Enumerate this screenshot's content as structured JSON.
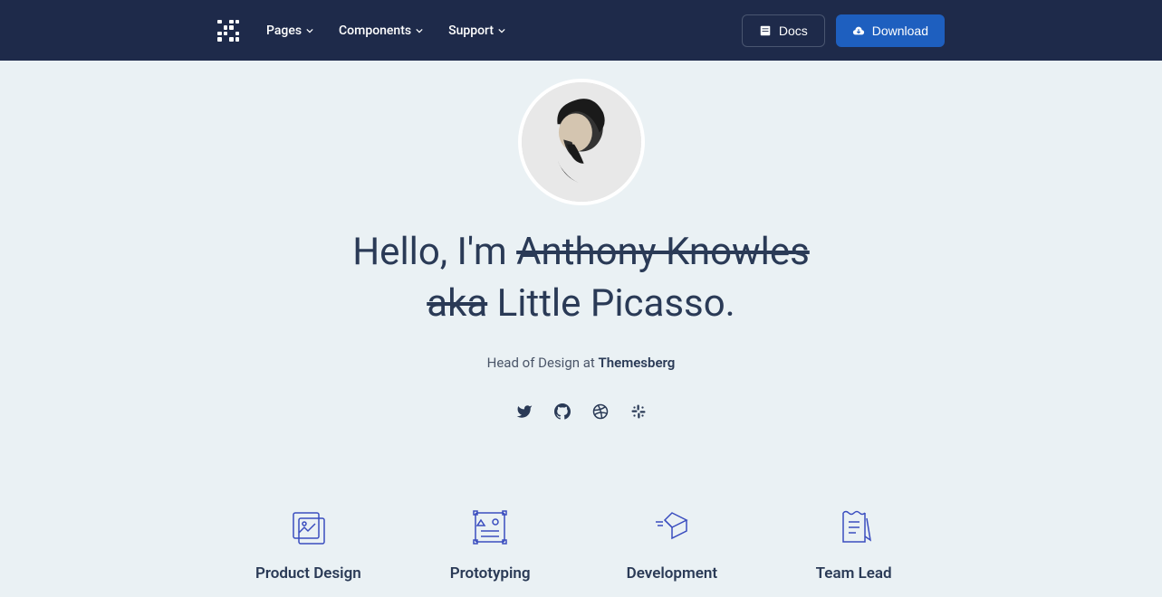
{
  "nav": {
    "menu": [
      "Pages",
      "Components",
      "Support"
    ],
    "docs": "Docs",
    "download": "Download"
  },
  "hero": {
    "greeting": "Hello, I'm ",
    "strike1": "Anthony Knowles",
    "strike2": "aka",
    "name": " Little Picasso.",
    "role": "Head of Design at ",
    "company": "Themesberg"
  },
  "skills": [
    {
      "title": "Product Design"
    },
    {
      "title": "Prototyping"
    },
    {
      "title": "Development"
    },
    {
      "title": "Team Lead"
    }
  ]
}
